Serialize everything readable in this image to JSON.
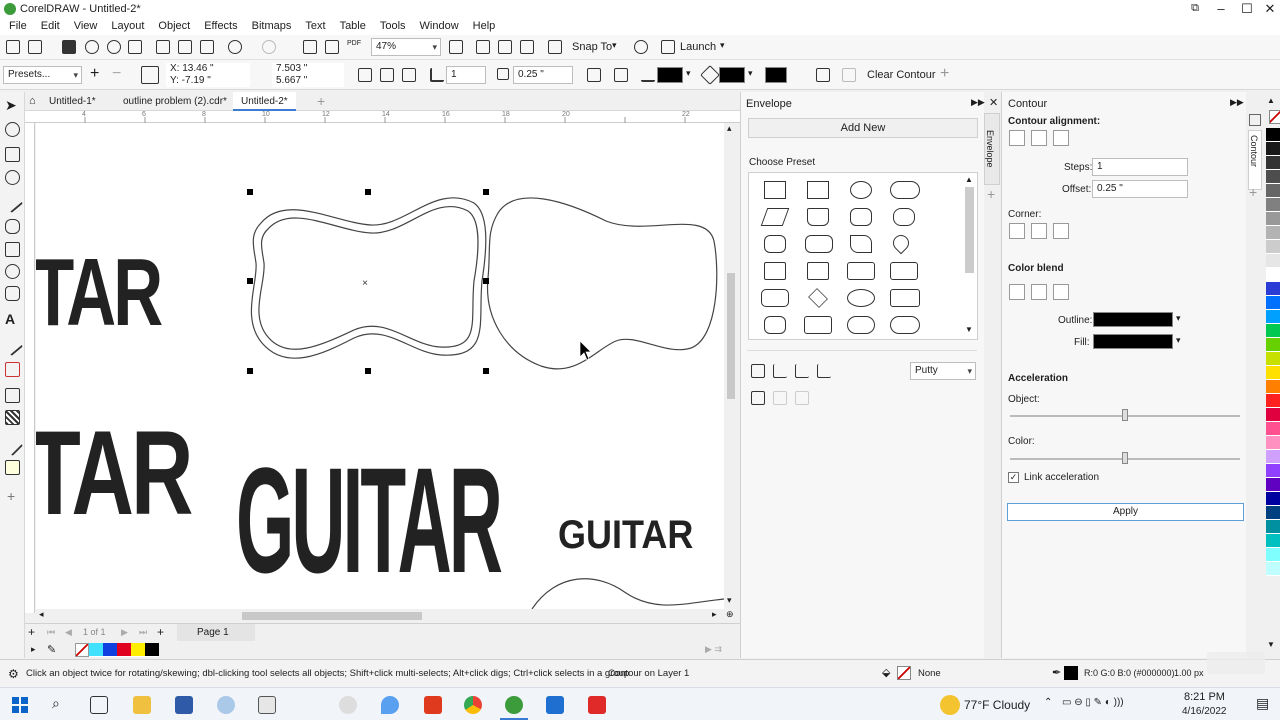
{
  "window": {
    "title": "CorelDRAW - Untitled-2*"
  },
  "menu": [
    "File",
    "Edit",
    "View",
    "Layout",
    "Object",
    "Effects",
    "Bitmaps",
    "Text",
    "Table",
    "Tools",
    "Window",
    "Help"
  ],
  "toolbar": {
    "zoom": "47%",
    "snap_to": "Snap To",
    "launch": "Launch"
  },
  "propbar": {
    "presets": "Presets...",
    "x": "X: 13.46 \"",
    "y": "Y: -7.19 \"",
    "w": "7.503 \"",
    "h": "5.667 \"",
    "steps": "1",
    "offset": "0.25 \"",
    "clear_contour": "Clear Contour"
  },
  "doc_tabs": [
    "Untitled-1*",
    "outline problem (2).cdr*",
    "Untitled-2*"
  ],
  "ruler_labels": [
    "4",
    "6",
    "8",
    "10",
    "12",
    "14",
    "16",
    "18",
    "20",
    "22"
  ],
  "canvas": {
    "text_guitar_left1": "TAR",
    "text_guitar_left2": "TAR",
    "text_guitar_big": "GUITAR",
    "text_guitar_small": "GUITAR"
  },
  "pagebar": {
    "page_count": "1 of 1",
    "page_tab": "Page 1"
  },
  "envelope": {
    "title": "Envelope",
    "add_new": "Add New",
    "choose_preset": "Choose Preset",
    "mode": "Putty",
    "side_tab": "Envelope"
  },
  "contour": {
    "title": "Contour",
    "alignment": "Contour alignment:",
    "steps_label": "Steps:",
    "steps_value": "1",
    "offset_label": "Offset:",
    "offset_value": "0.25 \"",
    "corner": "Corner:",
    "color_blend": "Color blend",
    "outline": "Outline:",
    "fill": "Fill:",
    "acceleration": "Acceleration",
    "object": "Object:",
    "color": "Color:",
    "link_accel": "Link acceleration",
    "apply": "Apply",
    "side_tab": "Contour"
  },
  "status": {
    "hint": "Click an object twice for rotating/skewing; dbl-clicking tool selects all objects; Shift+click multi-selects; Alt+click digs; Ctrl+click selects in a group",
    "layer": "Contour on Layer 1",
    "fill_none": "None",
    "outline_info": "R:0 G:0 B:0 (#000000)",
    "outline_width": "1.00 px"
  },
  "taskbar": {
    "weather": "77°F  Cloudy",
    "time": "8:21 PM",
    "date": "4/16/2022"
  },
  "colors": {
    "accent": "#3c9c3c",
    "palette": [
      "#000000",
      "#1a1a1a",
      "#333333",
      "#4d4d4d",
      "#666666",
      "#808080",
      "#999999",
      "#b3b3b3",
      "#cccccc",
      "#e6e6e6",
      "#ffffff",
      "#2b3bd6",
      "#0070ff",
      "#00a0ff",
      "#00c850",
      "#66d000",
      "#c8e000",
      "#ffe000",
      "#ff8000",
      "#ff2020",
      "#e00040",
      "#ff5090",
      "#ff90c0",
      "#d0a0ff",
      "#9040ff",
      "#6000c0",
      "#0000a0",
      "#004080",
      "#0090a0",
      "#00c0c0",
      "#80ffff",
      "#c0ffff"
    ]
  }
}
